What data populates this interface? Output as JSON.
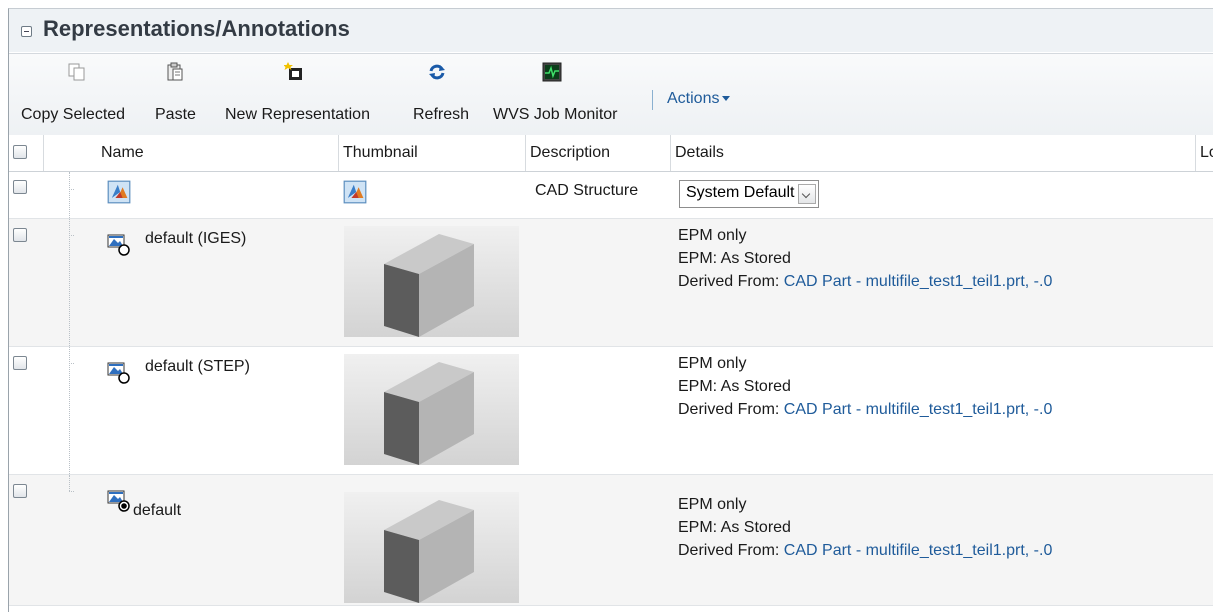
{
  "panel": {
    "title": "Representations/Annotations"
  },
  "toolbar": {
    "copy_selected": "Copy Selected",
    "paste": "Paste",
    "new_representation": "New Representation",
    "refresh": "Refresh",
    "wvs_job_monitor": "WVS Job Monitor",
    "actions": "Actions"
  },
  "columns": [
    "Name",
    "Thumbnail",
    "Description",
    "Details",
    "Lo"
  ],
  "rows": [
    {
      "name": "",
      "description": "CAD Structure",
      "select_value": "System Default",
      "icon": "cad-structure-icon"
    },
    {
      "name": "default (IGES)",
      "icon": "representation-icon",
      "details": [
        "EPM only",
        "EPM: As Stored"
      ],
      "derived_label": "Derived From: ",
      "derived_link": "CAD Part - multifile_test1_teil1.prt, -.0"
    },
    {
      "name": "default (STEP)",
      "icon": "representation-icon",
      "details": [
        "EPM only",
        "EPM: As Stored"
      ],
      "derived_label": "Derived From: ",
      "derived_link": "CAD Part - multifile_test1_teil1.prt, -.0"
    },
    {
      "name": "default",
      "icon": "default-representation-icon",
      "details": [
        "EPM only",
        "EPM: As Stored"
      ],
      "derived_label": "Derived From: ",
      "derived_link": "CAD Part - multifile_test1_teil1.prt, -.0"
    }
  ],
  "colors": {
    "link": "#1f5b9a",
    "title": "#333b44"
  }
}
